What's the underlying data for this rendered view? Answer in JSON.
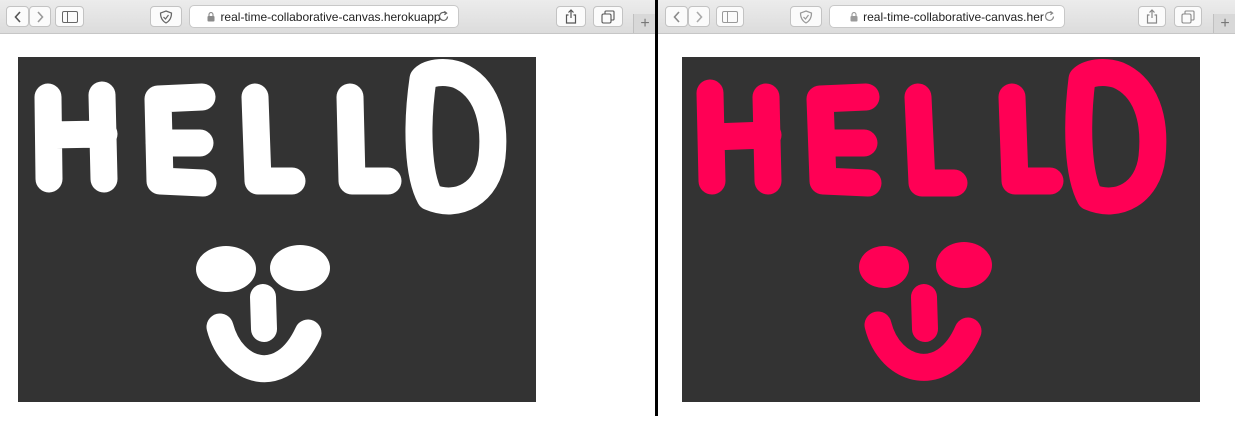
{
  "left_window": {
    "url": "real-time-collaborative-canvas.herokuapp",
    "canvas": {
      "background": "#333333",
      "stroke_color": "#ffffff",
      "drawn_text": "HELLO"
    }
  },
  "right_window": {
    "url": "real-time-collaborative-canvas.her",
    "canvas": {
      "background": "#333333",
      "stroke_color": "#ff0055",
      "drawn_text": "HELLO"
    }
  },
  "toolbar": {
    "new_tab_label": "+",
    "icons": [
      "back-icon",
      "forward-icon",
      "sidebar-icon",
      "shield-icon",
      "lock-icon",
      "reload-icon",
      "share-icon",
      "tabs-icon"
    ]
  }
}
